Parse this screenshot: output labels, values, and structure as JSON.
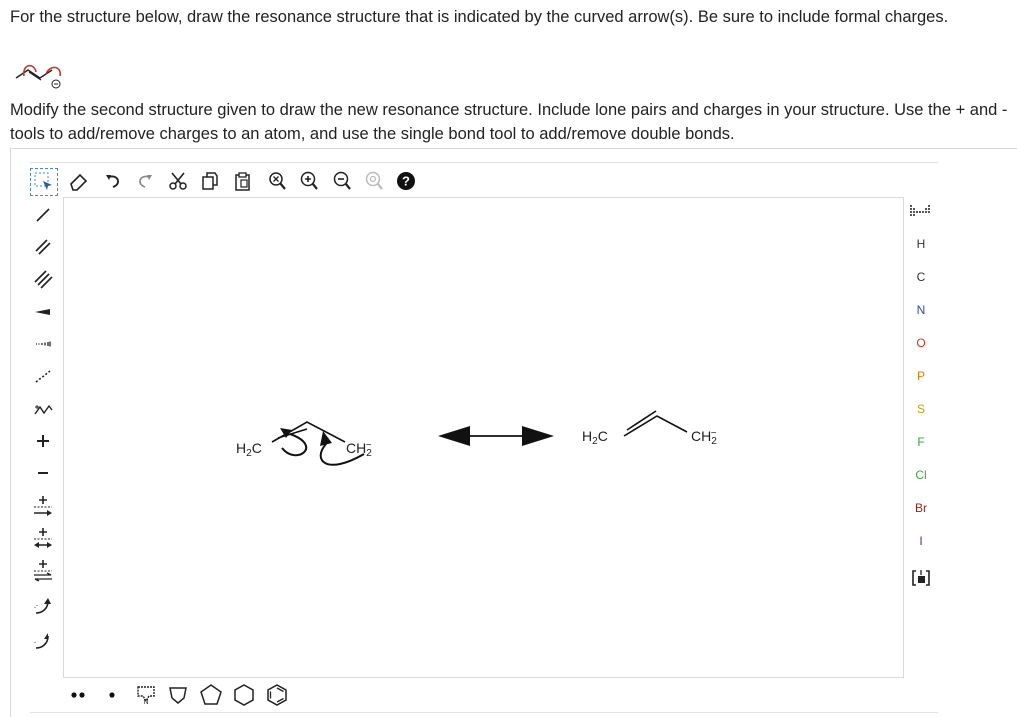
{
  "question": {
    "prompt": "For the structure below, draw the resonance structure that is indicated by the curved arrow(s). Be sure to include formal charges.",
    "instructions": "Modify the second structure given to draw the new resonance structure. Include lone pairs and charges in your structure. Use the + and - tools to add/remove charges to an atom, and use the single bond tool to add/remove double bonds."
  },
  "toolbar": {
    "top": [
      "select-tool",
      "eraser-icon",
      "undo-icon",
      "redo-icon",
      "cut-icon",
      "copy-icon",
      "paste-icon",
      "zoom-fit-icon",
      "zoom-in-icon",
      "zoom-out-icon",
      "zoom-reset-icon",
      "help-icon"
    ],
    "left": [
      "single-bond-icon",
      "double-bond-icon",
      "triple-bond-icon",
      "wedge-bond-icon",
      "hash-bond-icon",
      "dashed-bond-icon",
      "chain-icon",
      "plus-charge-icon",
      "minus-charge-icon",
      "add-plus-charge-arrow-icon",
      "add-plus-charge-double-arrow-icon",
      "add-plus-charge-equilibrium-icon",
      "curved-arrow-icon",
      "single-electron-arrow-icon"
    ],
    "bottom": [
      "lone-pair-icon",
      "radical-icon",
      "template-icon",
      "cyclobutane-icon",
      "cyclopentane-icon",
      "cyclohexane-icon",
      "benzene-icon"
    ]
  },
  "elements": [
    "H",
    "C",
    "N",
    "O",
    "P",
    "S",
    "F",
    "Cl",
    "Br",
    "I"
  ],
  "element_colors": {
    "H": "#333333",
    "C": "#333333",
    "N": "#2e4da8",
    "O": "#d9341c",
    "P": "#e07b12",
    "S": "#c2a500",
    "F": "#3aa63a",
    "Cl": "#3aa63a",
    "Br": "#8b2a1a",
    "I": "#5a2a8a"
  },
  "molecules": {
    "left": {
      "h2c": "H",
      "h2c_sub": "2",
      "h2c_c": "C",
      "ch2": "CH",
      "ch2_sub": "2",
      "ch2_charge": "−"
    },
    "right": {
      "h2c": "H",
      "h2c_sub": "2",
      "h2c_c": "C",
      "ch2": "CH",
      "ch2_sub": "2",
      "ch2_charge": "−"
    }
  },
  "resonance_arrow": "double-headed-arrow"
}
